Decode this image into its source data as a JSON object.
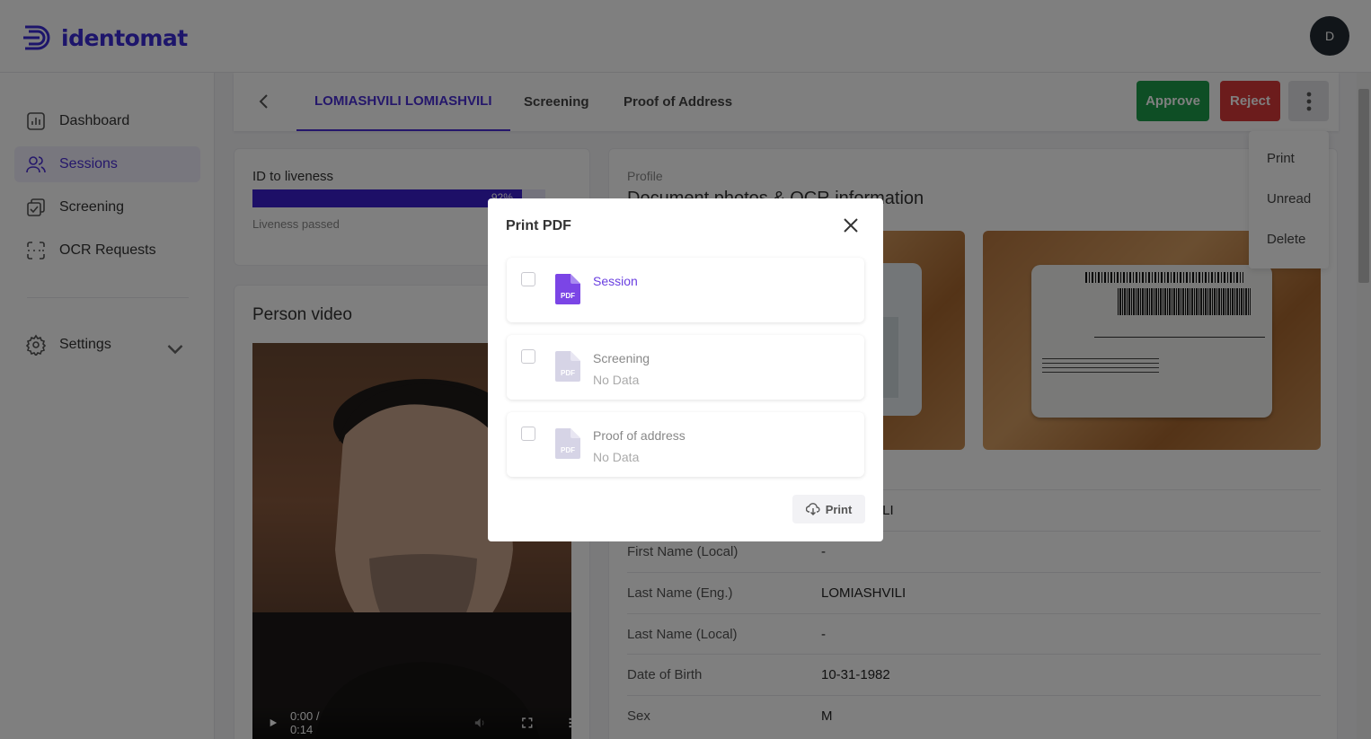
{
  "brand": {
    "name": "identomat",
    "color": "#3b2bd6"
  },
  "user": {
    "avatar_initial": "D"
  },
  "sidebar": {
    "items": [
      {
        "label": "Dashboard",
        "icon": "chart-icon"
      },
      {
        "label": "Sessions",
        "icon": "users-icon",
        "active": true
      },
      {
        "label": "Screening",
        "icon": "screening-icon"
      },
      {
        "label": "OCR Requests",
        "icon": "scan-icon"
      }
    ],
    "settings": {
      "label": "Settings",
      "icon": "gear-icon"
    }
  },
  "tabs": [
    {
      "label": "LOMIASHVILI LOMIASHVILI",
      "active": true
    },
    {
      "label": "Screening"
    },
    {
      "label": "Proof of Address"
    }
  ],
  "actions": {
    "approve": "Approve",
    "reject": "Reject"
  },
  "dropdown": {
    "items": [
      "Print",
      "Unread",
      "Delete"
    ]
  },
  "liveness": {
    "title": "ID to liveness",
    "percent_label": "92%",
    "percent": 92,
    "status": "Liveness passed"
  },
  "video": {
    "title": "Person video",
    "time": "0:00 / 0:14"
  },
  "profile": {
    "label": "Profile",
    "heading": "Document photos & OCR information",
    "partial_value": "ILI",
    "rows": [
      {
        "key": "First Name (Local)",
        "value": "-"
      },
      {
        "key": "Last Name (Eng.)",
        "value": "LOMIASHVILI"
      },
      {
        "key": "Last Name (Local)",
        "value": "-"
      },
      {
        "key": "Date of Birth",
        "value": "10-31-1982"
      },
      {
        "key": "Sex",
        "value": "M"
      }
    ]
  },
  "modal": {
    "title": "Print PDF",
    "options": [
      {
        "label": "Session",
        "sub": "",
        "enabled": true
      },
      {
        "label": "Screening",
        "sub": "No Data",
        "enabled": false
      },
      {
        "label": "Proof of address",
        "sub": "No Data",
        "enabled": false
      }
    ],
    "pdf_badge": "PDF",
    "print_label": "Print"
  },
  "colors": {
    "accent": "#4a2fd6",
    "approve": "#1c9c4a",
    "reject": "#d93838",
    "pdf_active": "#7b45e6",
    "pdf_inactive": "#d6d4e6"
  }
}
